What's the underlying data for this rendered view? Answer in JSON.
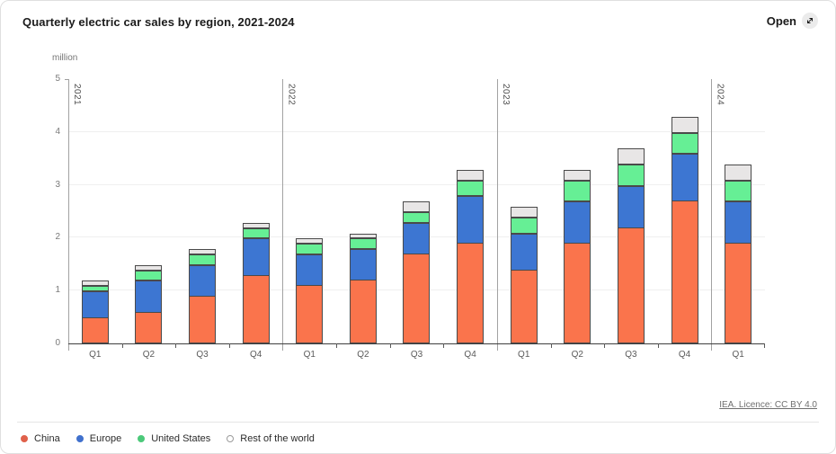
{
  "header": {
    "open_label": "Open",
    "open_icon": "arrow-up-right-expand"
  },
  "chart_data": {
    "type": "bar",
    "stacked": true,
    "title": "Quarterly electric car sales by region, 2021-2024",
    "unit_label": "million",
    "ylim": [
      0,
      5
    ],
    "yticks": [
      0,
      1,
      2,
      3,
      4,
      5
    ],
    "grid": "horizontal",
    "legend_position": "bottom-left",
    "bar_border_color": "#4A4A4A",
    "years": [
      {
        "label": "2021",
        "quarters": [
          "Q1",
          "Q2",
          "Q3",
          "Q4"
        ]
      },
      {
        "label": "2022",
        "quarters": [
          "Q1",
          "Q2",
          "Q3",
          "Q4"
        ]
      },
      {
        "label": "2023",
        "quarters": [
          "Q1",
          "Q2",
          "Q3",
          "Q4"
        ]
      },
      {
        "label": "2024",
        "quarters": [
          "Q1"
        ]
      }
    ],
    "categories": [
      "2021 Q1",
      "2021 Q2",
      "2021 Q3",
      "2021 Q4",
      "2022 Q1",
      "2022 Q2",
      "2022 Q3",
      "2022 Q4",
      "2023 Q1",
      "2023 Q2",
      "2023 Q3",
      "2023 Q4",
      "2024 Q1"
    ],
    "series": [
      {
        "name": "China",
        "color": "#FA744C",
        "legend_fill": "#E0614B",
        "legend_border": "#E0614B",
        "values": [
          0.5,
          0.6,
          0.9,
          1.3,
          1.1,
          1.2,
          1.7,
          1.9,
          1.4,
          1.9,
          2.2,
          2.7,
          1.9
        ]
      },
      {
        "name": "Europe",
        "color": "#3D76D2",
        "legend_fill": "#4071CD",
        "legend_border": "#4071CD",
        "values": [
          0.5,
          0.6,
          0.6,
          0.7,
          0.6,
          0.6,
          0.6,
          0.9,
          0.7,
          0.8,
          0.8,
          0.9,
          0.8
        ]
      },
      {
        "name": "United States",
        "color": "#66EF95",
        "legend_fill": "#4CC97A",
        "legend_border": "#4CC97A",
        "values": [
          0.1,
          0.2,
          0.2,
          0.2,
          0.2,
          0.2,
          0.2,
          0.3,
          0.3,
          0.4,
          0.4,
          0.4,
          0.4
        ]
      },
      {
        "name": "Rest of the world",
        "color": "#E8E6E6",
        "legend_fill": "#FFFFFF",
        "legend_border": "#9A9A9A",
        "values": [
          0.1,
          0.1,
          0.1,
          0.1,
          0.1,
          0.1,
          0.2,
          0.2,
          0.2,
          0.2,
          0.3,
          0.3,
          0.3
        ]
      }
    ],
    "totals": [
      1.2,
      1.5,
      1.8,
      2.3,
      2.0,
      2.1,
      2.7,
      3.3,
      2.6,
      3.3,
      3.7,
      4.3,
      3.4
    ]
  },
  "footer": {
    "source": "IEA. Licence: CC BY 4.0"
  }
}
